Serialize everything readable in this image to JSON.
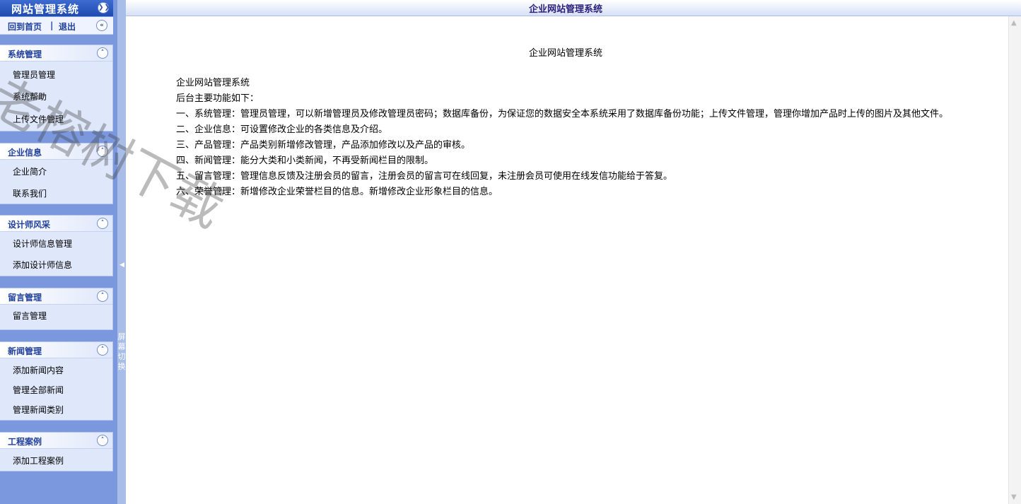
{
  "sidebar": {
    "title": "网站管理系统",
    "home_link": "回到首页",
    "separator": "|",
    "logout_link": "退出",
    "switch_label": "屏幕切换",
    "groups": [
      {
        "title": "系统管理",
        "items": [
          "管理员管理",
          "系统帮助",
          "上传文件管理"
        ]
      },
      {
        "title": "企业信息",
        "items": [
          "企业简介",
          "联系我们"
        ]
      },
      {
        "title": "设计师风采",
        "items": [
          "设计师信息管理",
          "添加设计师信息"
        ]
      },
      {
        "title": "留言管理",
        "items": [
          "留言管理"
        ]
      },
      {
        "title": "新闻管理",
        "items": [
          "添加新闻内容",
          "管理全部新闻",
          "管理新闻类别"
        ]
      },
      {
        "title": "工程案例",
        "items": [
          "添加工程案例"
        ]
      }
    ]
  },
  "header": {
    "title": "企业网站管理系统"
  },
  "main": {
    "heading": "企业网站管理系统",
    "lines": [
      "企业网站管理系统",
      "后台主要功能如下：",
      "一、系统管理：管理员管理，可以新增管理员及修改管理员密码；数据库备份，为保证您的数据安全本系统采用了数据库备份功能；上传文件管理，管理你增加产品时上传的图片及其他文件。",
      "二、企业信息：可设置修改企业的各类信息及介绍。",
      "三、产品管理：产品类别新增修改管理，产品添加修改以及产品的审核。",
      "四、新闻管理：能分大类和小类新闻，不再受新闻栏目的限制。",
      "五、留言管理：管理信息反馈及注册会员的留言，注册会员的留言可在线回复，未注册会员可使用在线发信功能给于答复。",
      "六、荣誉管理：新增修改企业荣誉栏目的信息。新增修改企业形象栏目的信息。"
    ]
  },
  "watermark": "老榕树下载",
  "icons": {
    "collapse_all": "double-chevron-down-icon",
    "collapse_group": "double-chevron-up-icon",
    "collapse_sidebar": "double-chevron-left-icon"
  },
  "colors": {
    "sidebar_bg": "#7b98de",
    "title_bar": "#2a55b8",
    "group_title": "#1f3f9a"
  }
}
